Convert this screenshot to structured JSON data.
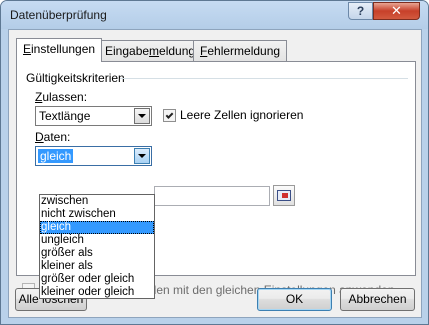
{
  "window": {
    "title": "Datenüberprüfung",
    "help_label": "?",
    "close_label": "✕"
  },
  "tabs": [
    {
      "label_prefix": "",
      "label_mnemonic": "E",
      "label_rest": "instellungen",
      "active": true
    },
    {
      "label_prefix": "Eingabe",
      "label_mnemonic": "m",
      "label_rest": "eldung",
      "active": false
    },
    {
      "label_prefix": "",
      "label_mnemonic": "F",
      "label_rest": "ehlermeldung",
      "active": false
    }
  ],
  "settings": {
    "group_label": "Gültigkeitskriterien",
    "allow_label_mnemonic": "Z",
    "allow_label_rest": "ulassen:",
    "allow_value": "Textlänge",
    "ignore_blank_label": "Leere Zellen ignorieren",
    "ignore_blank_checked": true,
    "data_label_mnemonic": "D",
    "data_label_rest": "aten:",
    "data_value": "gleich",
    "data_options": [
      "zwischen",
      "nicht zwischen",
      "gleich",
      "ungleich",
      "größer als",
      "kleiner als",
      "größer oder gleich",
      "kleiner oder gleich"
    ],
    "data_selected_index": 2,
    "apply_all_text": "llen mit den gleichen Einstellungen anwenden"
  },
  "buttons": {
    "clear_all": "Alle löschen",
    "ok": "OK",
    "cancel": "Abbrechen"
  },
  "icons": {
    "close": "close-icon",
    "dropdown": "chevron-down-icon",
    "reference": "range-selector-icon",
    "check": "checkmark-icon"
  },
  "colors": {
    "title_bar": "#c6dbf2",
    "close_button": "#c7402a",
    "selection": "#3399ff"
  }
}
